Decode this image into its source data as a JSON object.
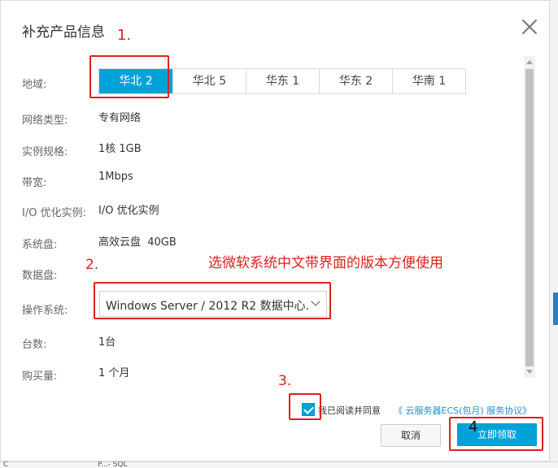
{
  "dialog": {
    "title": "补充产品信息"
  },
  "regions": {
    "label": "地域:",
    "options": [
      "华北 2",
      "华北 5",
      "华东 1",
      "华东 2",
      "华南 1"
    ],
    "selected": "华北 2"
  },
  "fields": {
    "network_type": {
      "label": "网络类型:",
      "value": "专有网络"
    },
    "instance_spec": {
      "label": "实例规格:",
      "value": "1核 1GB"
    },
    "bandwidth": {
      "label": "带宽:",
      "value": "1Mbps"
    },
    "io_optimized": {
      "label": "I/O 优化实例:",
      "value": "I/O 优化实例"
    },
    "system_disk": {
      "label": "系统盘:",
      "value": "高效云盘  40GB"
    },
    "data_disk": {
      "label": "数据盘:"
    },
    "os": {
      "label": "操作系统:",
      "value": "Windows Server / 2012 R2 数据中心..."
    },
    "count": {
      "label": "台数:",
      "value": "1台"
    },
    "duration": {
      "label": "购买量:",
      "value": "1 个月"
    }
  },
  "agreement": {
    "checked": true,
    "text": "我已阅读并同意",
    "link": "《 云服务器ECS(包月) 服务协议》"
  },
  "buttons": {
    "cancel": "取消",
    "confirm": "立即领取"
  },
  "annotations": {
    "step1": "1.",
    "step2": "2.",
    "step3": "3.",
    "step4": "4",
    "note": "选微软系统中文带界面的版本方便使用"
  },
  "background": {
    "bottom_text_1": "C",
    "bottom_text_2": "P...- SQL"
  },
  "colors": {
    "primary": "#00a3d9",
    "annotation_red": "#e0201b",
    "link": "#1a8fd6"
  }
}
